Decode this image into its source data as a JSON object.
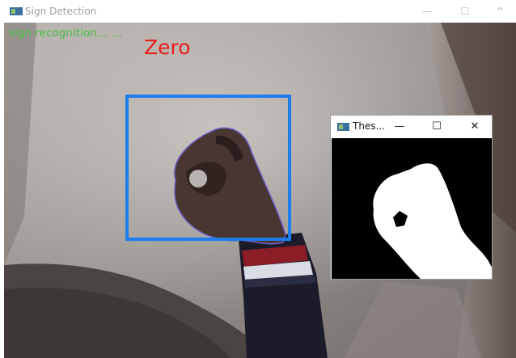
{
  "main_window": {
    "title": "Sign Detection",
    "controls": {
      "minimize": "—",
      "maximize": "☐",
      "close": "^"
    }
  },
  "camera": {
    "status_text": "sign recognition... ...",
    "prediction": "Zero",
    "colors": {
      "status": "#3fc13f",
      "prediction": "#ea1c1c",
      "roi_box": "#1e7df0"
    }
  },
  "threshold_window": {
    "title": "Thes...",
    "controls": {
      "minimize": "—",
      "maximize": "☐",
      "close": "✕"
    }
  },
  "icons": [
    "app-icon",
    "minimize-icon",
    "maximize-icon",
    "close-icon"
  ]
}
